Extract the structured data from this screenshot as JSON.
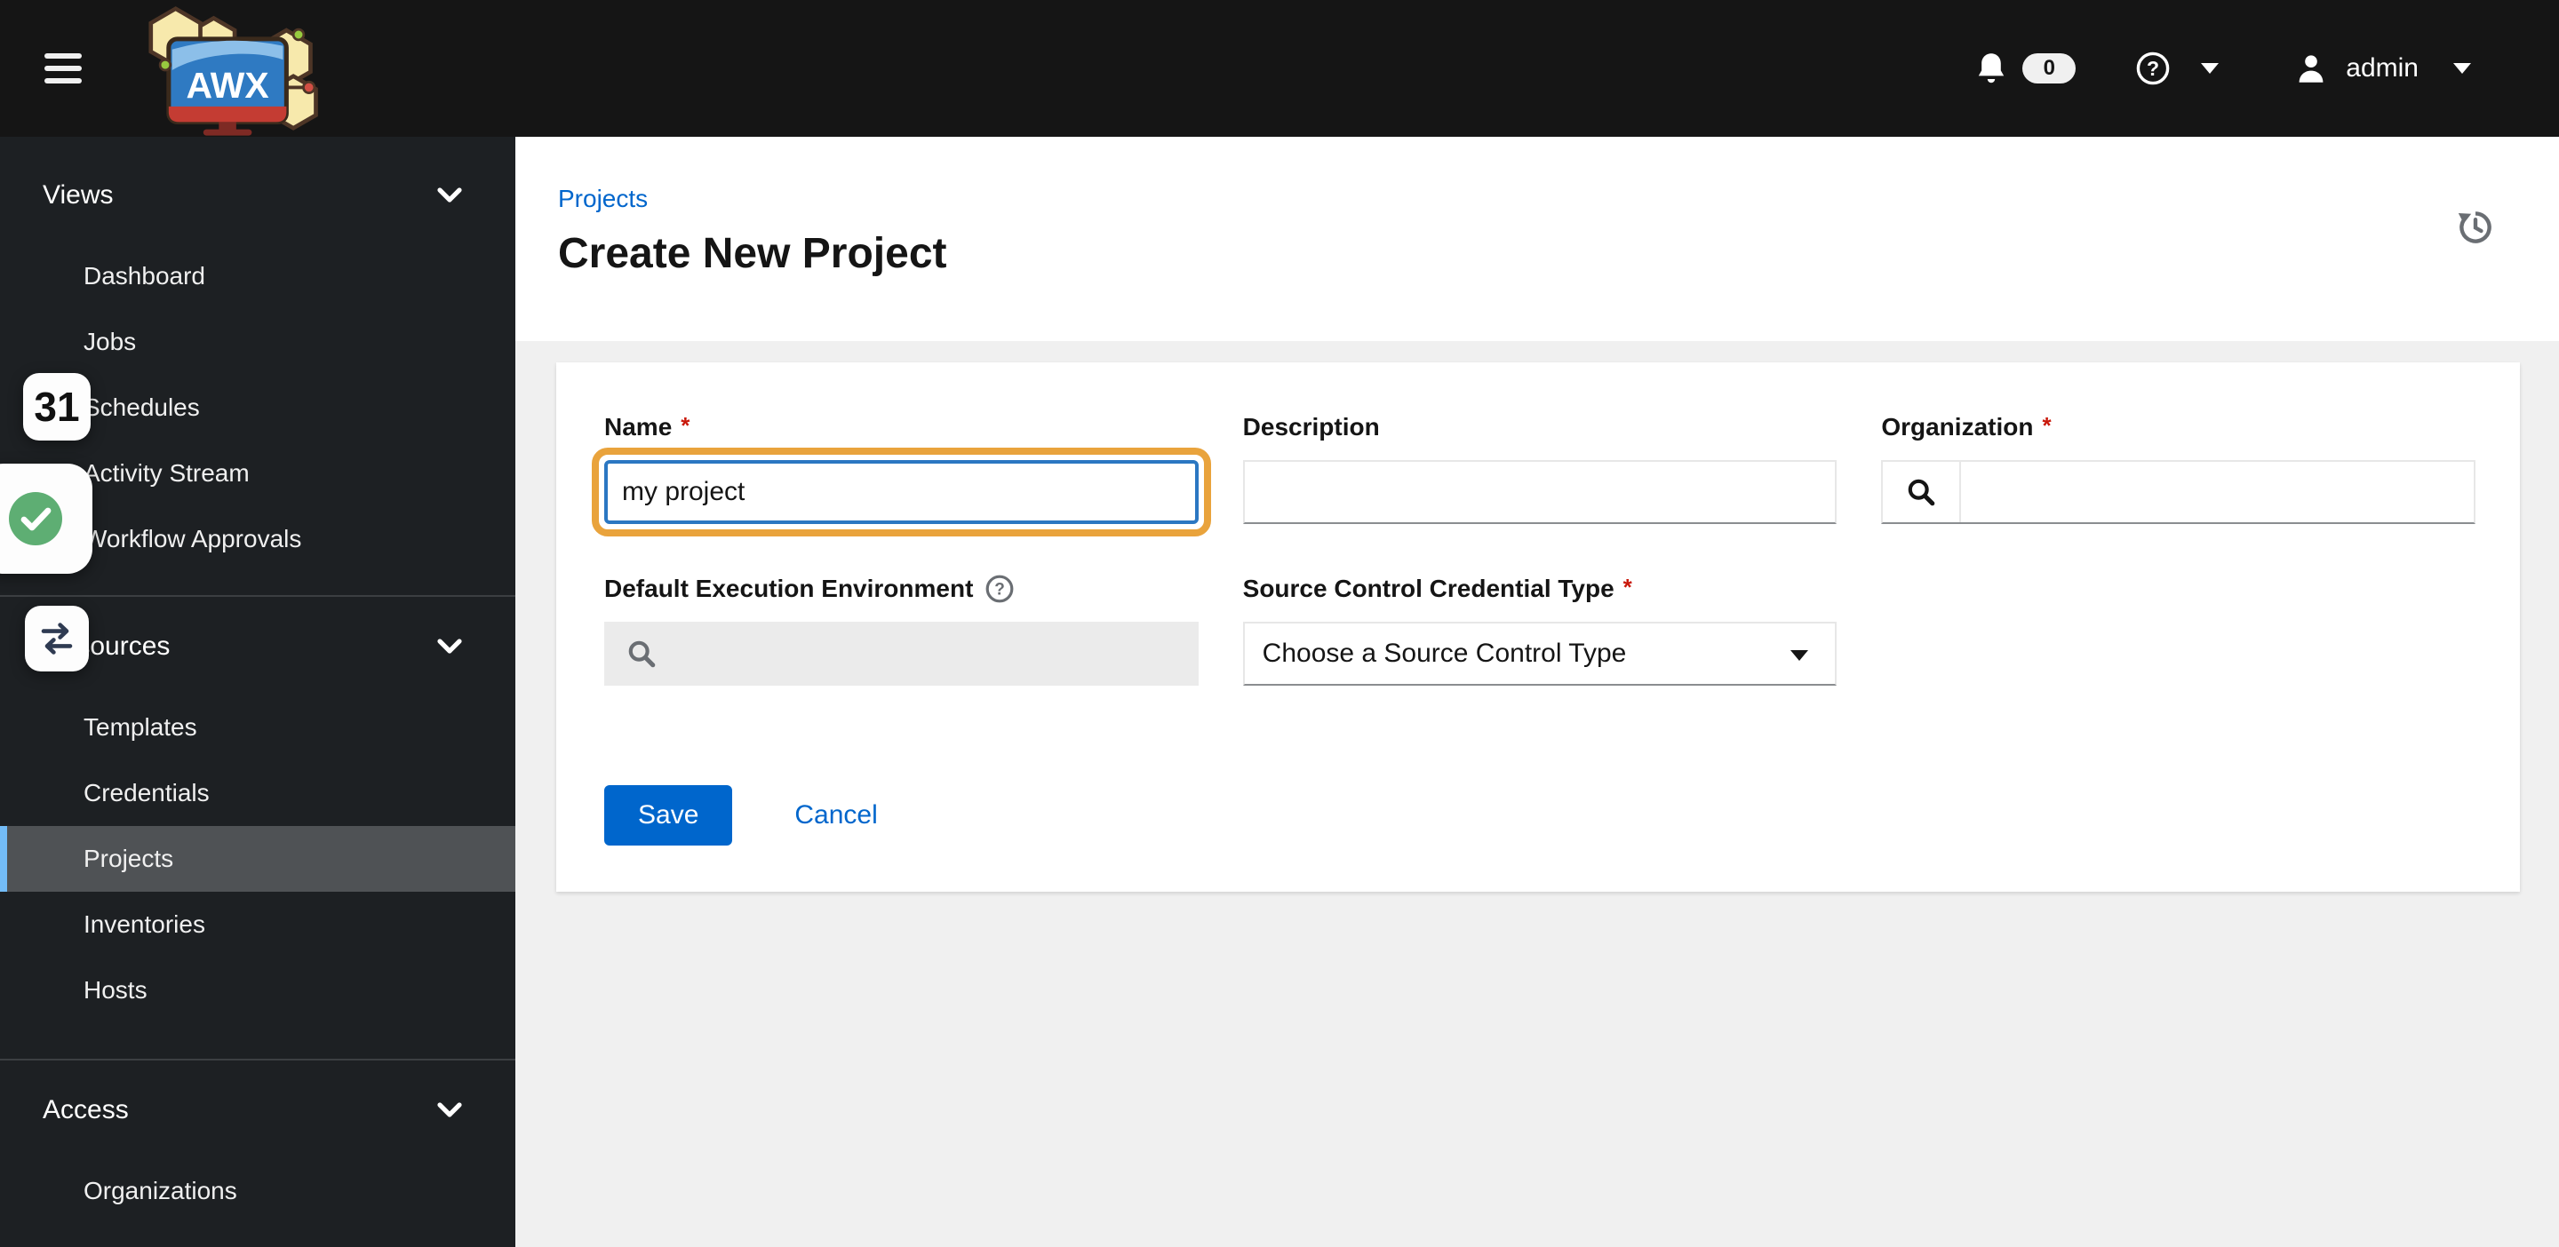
{
  "masthead": {
    "logo_text": "AWX",
    "notifications": {
      "count": "0"
    },
    "user": {
      "name": "admin"
    },
    "icons": {
      "menu": "hamburger-menu-icon",
      "notifications": "bell-icon",
      "help": "question-circle-icon",
      "user": "user-icon",
      "dropdown": "caret-down-icon"
    }
  },
  "sidebar": {
    "groups": [
      {
        "label": "Views",
        "items": [
          {
            "label": "Dashboard"
          },
          {
            "label": "Jobs"
          },
          {
            "label": "Schedules"
          },
          {
            "label": "Activity Stream"
          },
          {
            "label": "Workflow Approvals"
          }
        ]
      },
      {
        "label": "Resources",
        "items": [
          {
            "label": "Templates"
          },
          {
            "label": "Credentials"
          },
          {
            "label": "Projects",
            "selected": true
          },
          {
            "label": "Inventories"
          },
          {
            "label": "Hosts"
          }
        ]
      },
      {
        "label": "Access",
        "items": [
          {
            "label": "Organizations"
          }
        ]
      }
    ]
  },
  "overlays": {
    "counter_badge": "31",
    "icons": {
      "success": "check-circle-icon",
      "switch": "swap-arrows-icon"
    }
  },
  "page": {
    "breadcrumb": "Projects",
    "title": "Create New Project",
    "icons": {
      "history": "history-icon"
    }
  },
  "form": {
    "fields": {
      "name": {
        "label": "Name",
        "required": "*",
        "value": "my project"
      },
      "description": {
        "label": "Description",
        "value": ""
      },
      "organization": {
        "label": "Organization",
        "required": "*",
        "value": ""
      },
      "execution_environment": {
        "label": "Default Execution Environment",
        "value": ""
      },
      "scm_credential_type": {
        "label": "Source Control Credential Type",
        "required": "*",
        "selected": "Choose a Source Control Type"
      }
    },
    "actions": {
      "save": "Save",
      "cancel": "Cancel"
    }
  },
  "colors": {
    "masthead_bg": "#151515",
    "sidebar_bg": "#1d2023",
    "selected_item_bg": "#4f5255",
    "selected_item_accent": "#73bcf7",
    "brand_blue": "#0066cc",
    "focus_blue": "#2b77c2",
    "required_red": "#c9190b",
    "highlight_orange": "#e9a33c",
    "page_bg": "#f0f0f0",
    "success_green": "#5eae73"
  }
}
